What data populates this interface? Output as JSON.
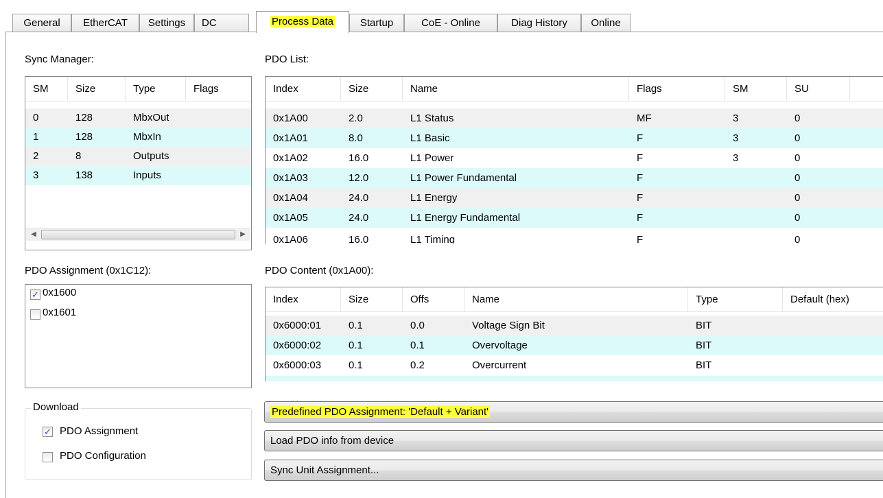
{
  "tabs": [
    {
      "label": "General"
    },
    {
      "label": "EtherCAT"
    },
    {
      "label": "Settings"
    },
    {
      "label": "DC"
    },
    {
      "label": "Process Data"
    },
    {
      "label": "Startup"
    },
    {
      "label": "CoE - Online"
    },
    {
      "label": "Diag History"
    },
    {
      "label": "Online"
    }
  ],
  "active_tab": "Process Data",
  "sync_manager": {
    "label": "Sync Manager:",
    "columns": [
      "SM",
      "Size",
      "Type",
      "Flags"
    ],
    "rows": [
      [
        "0",
        "128",
        "MbxOut",
        ""
      ],
      [
        "1",
        "128",
        "MbxIn",
        ""
      ],
      [
        "2",
        "8",
        "Outputs",
        ""
      ],
      [
        "3",
        "138",
        "Inputs",
        ""
      ]
    ]
  },
  "pdo_list": {
    "label": "PDO List:",
    "columns": [
      "Index",
      "Size",
      "Name",
      "Flags",
      "SM",
      "SU"
    ],
    "rows": [
      [
        "0x1A00",
        "2.0",
        "L1 Status",
        "MF",
        "3",
        "0"
      ],
      [
        "0x1A01",
        "8.0",
        "L1 Basic",
        "F",
        "3",
        "0"
      ],
      [
        "0x1A02",
        "16.0",
        "L1 Power",
        "F",
        "3",
        "0"
      ],
      [
        "0x1A03",
        "12.0",
        "L1 Power Fundamental",
        "F",
        "",
        "0"
      ],
      [
        "0x1A04",
        "24.0",
        "L1 Energy",
        "F",
        "",
        "0"
      ],
      [
        "0x1A05",
        "24.0",
        "L1 Energy Fundamental",
        "F",
        "",
        "0"
      ],
      [
        "0x1A06",
        "16.0",
        "L1 Timing",
        "F",
        "",
        "0"
      ]
    ]
  },
  "pdo_assignment": {
    "label": "PDO Assignment (0x1C12):",
    "items": [
      {
        "label": "0x1600",
        "checked": true
      },
      {
        "label": "0x1601",
        "checked": false
      }
    ]
  },
  "pdo_content": {
    "label": "PDO Content (0x1A00):",
    "columns": [
      "Index",
      "Size",
      "Offs",
      "Name",
      "Type",
      "Default (hex)"
    ],
    "rows": [
      [
        "0x6000:01",
        "0.1",
        "0.0",
        "Voltage Sign Bit",
        "BIT",
        ""
      ],
      [
        "0x6000:02",
        "0.1",
        "0.1",
        "Overvoltage",
        "BIT",
        ""
      ],
      [
        "0x6000:03",
        "0.1",
        "0.2",
        "Overcurrent",
        "BIT",
        ""
      ]
    ]
  },
  "download": {
    "legend": "Download",
    "pdo_assignment": {
      "label": "PDO Assignment",
      "checked": true
    },
    "pdo_configuration": {
      "label": "PDO Configuration",
      "checked": false
    }
  },
  "buttons": {
    "predefined": "Predefined PDO Assignment: 'Default + Variant'",
    "load_pdo": "Load PDO info from device",
    "sync_unit": "Sync Unit Assignment..."
  },
  "colors": {
    "highlight": "#ffff3c",
    "row_alt": "#dcfafa",
    "row_gray": "#f0f0f0"
  }
}
